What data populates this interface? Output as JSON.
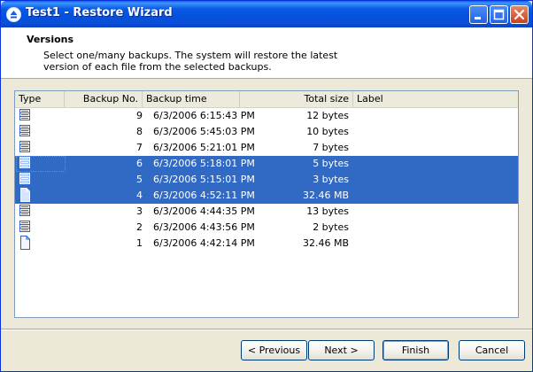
{
  "window": {
    "title": "Test1 - Restore Wizard"
  },
  "header": {
    "title": "Versions",
    "description": "Select one/many backups. The system will restore the latest version of each file from the selected backups."
  },
  "columns": {
    "type": "Type",
    "backup_no": "Backup No.",
    "backup_time": "Backup time",
    "total_size": "Total size",
    "label": "Label"
  },
  "rows": [
    {
      "icon": "stacked-files-icon",
      "no": "9",
      "time": "6/3/2006 6:15:43 PM",
      "size": "12 bytes",
      "selected": false
    },
    {
      "icon": "stacked-files-icon",
      "no": "8",
      "time": "6/3/2006 5:45:03 PM",
      "size": "10 bytes",
      "selected": false
    },
    {
      "icon": "stacked-files-icon",
      "no": "7",
      "time": "6/3/2006 5:21:01 PM",
      "size": "7 bytes",
      "selected": false
    },
    {
      "icon": "stacked-files-icon",
      "no": "6",
      "time": "6/3/2006 5:18:01 PM",
      "size": "5 bytes",
      "selected": true
    },
    {
      "icon": "stacked-files-icon",
      "no": "5",
      "time": "6/3/2006 5:15:01 PM",
      "size": "3 bytes",
      "selected": true
    },
    {
      "icon": "file-icon",
      "no": "4",
      "time": "6/3/2006 4:52:11 PM",
      "size": "32.46 MB",
      "selected": true
    },
    {
      "icon": "stacked-files-icon",
      "no": "3",
      "time": "6/3/2006 4:44:35 PM",
      "size": "13 bytes",
      "selected": false
    },
    {
      "icon": "stacked-files-icon",
      "no": "2",
      "time": "6/3/2006 4:43:56 PM",
      "size": "2 bytes",
      "selected": false
    },
    {
      "icon": "file-icon",
      "no": "1",
      "time": "6/3/2006 4:42:14 PM",
      "size": "32.46 MB",
      "selected": false
    }
  ],
  "buttons": {
    "previous": "< Previous",
    "next": "Next >",
    "finish": "Finish",
    "cancel": "Cancel"
  },
  "colors": {
    "selection": "#316ac5",
    "titlebar": "#0a5ae3",
    "dialog_bg": "#ece9d8"
  }
}
